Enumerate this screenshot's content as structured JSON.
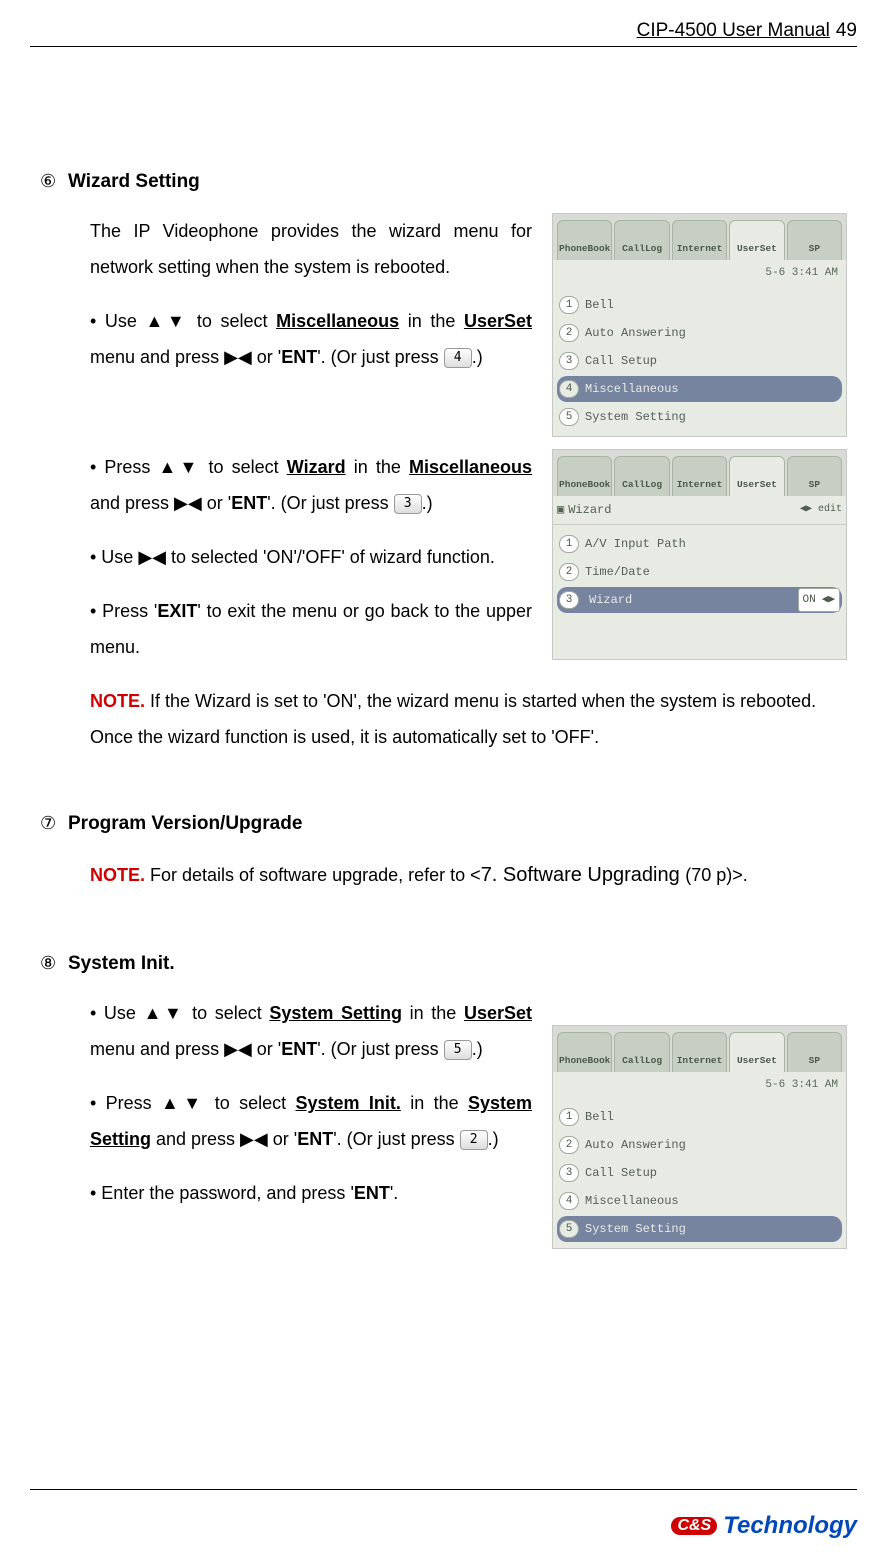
{
  "header": {
    "manual_title": "CIP-4500 User Manual",
    "page_no": "49"
  },
  "section6": {
    "marker": "⑥",
    "title": "Wizard Setting",
    "intro": "The IP Videophone provides the wizard menu for network setting when the system is rebooted.",
    "bullet1_a": "• Use ▲▼ to select ",
    "bullet1_b": "Miscellaneous",
    "bullet1_c": " in the ",
    "bullet1_d": "UserSet",
    "bullet1_e": " menu and press ▶◀ or '",
    "bullet1_f": "ENT",
    "bullet1_g": "'. (Or just press ",
    "bullet1_key": "4",
    "bullet1_h": ".)",
    "bullet2_a": "• Press ▲▼ to select ",
    "bullet2_b": "Wizard",
    "bullet2_c": " in the ",
    "bullet2_d": "Miscellaneous",
    "bullet2_e": " and press ▶◀ or '",
    "bullet2_f": "ENT",
    "bullet2_g": "'. (Or just press ",
    "bullet2_key": "3",
    "bullet2_h": ".)",
    "bullet3": "• Use ▶◀ to selected 'ON'/'OFF' of wizard function.",
    "bullet4_a": "• Press '",
    "bullet4_b": "EXIT",
    "bullet4_c": "' to exit the menu or go back to the upper menu.",
    "note_label": "NOTE.",
    "note_text": " If the Wizard is set to 'ON', the wizard menu is started when the system is rebooted. Once the wizard function is used, it is automatically set to 'OFF'."
  },
  "screenshot1": {
    "tabs": [
      "PhoneBook",
      "CallLog",
      "Internet",
      "UserSet",
      "SP"
    ],
    "active_tab_index": 3,
    "status": "5-6   3:41 AM",
    "items": [
      {
        "num": "1",
        "label": "Bell"
      },
      {
        "num": "2",
        "label": "Auto Answering"
      },
      {
        "num": "3",
        "label": "Call Setup"
      },
      {
        "num": "4",
        "label": "Miscellaneous"
      },
      {
        "num": "5",
        "label": "System Setting"
      }
    ],
    "selected_index": 3
  },
  "screenshot2": {
    "tabs": [
      "PhoneBook",
      "CallLog",
      "Internet",
      "UserSet",
      "SP"
    ],
    "active_tab_index": 3,
    "header_item": {
      "label": "Wizard",
      "action": "◀▶ edit"
    },
    "rows": [
      {
        "num": "1",
        "label": "A/V Input Path",
        "type": "item"
      },
      {
        "num": "2",
        "label": "Time/Date",
        "type": "item"
      },
      {
        "num": "3",
        "label": "Wizard",
        "type": "select",
        "value": "ON"
      }
    ],
    "selected_index": 2
  },
  "section7": {
    "marker": "⑦",
    "title": "Program Version/Upgrade",
    "note_label": "NOTE.",
    "note_text_a": " For details of software upgrade, refer to <",
    "note_text_b": "7. Software Upgrading ",
    "note_text_c": "(70 p)>."
  },
  "section8": {
    "marker": "⑧",
    "title": "System Init.",
    "bullet1_a": "• Use ▲▼ to select ",
    "bullet1_b": "System Setting",
    "bullet1_c": " in the ",
    "bullet1_d": "UserSet",
    "bullet1_e": " menu and press ▶◀ or '",
    "bullet1_f": "ENT",
    "bullet1_g": "'. (Or just press ",
    "bullet1_key": "5",
    "bullet1_h": ".)",
    "bullet2_a": "• Press ▲▼ to select ",
    "bullet2_b": "System Init.",
    "bullet2_c": " in the ",
    "bullet2_d": "System Setting",
    "bullet2_e": " and press ▶◀ or '",
    "bullet2_f": "ENT",
    "bullet2_g": "'. (Or just press ",
    "bullet2_key": "2",
    "bullet2_h": ".)",
    "bullet3_a": "• Enter the password, and press '",
    "bullet3_b": "ENT",
    "bullet3_c": "'."
  },
  "screenshot3": {
    "tabs": [
      "PhoneBook",
      "CallLog",
      "Internet",
      "UserSet",
      "SP"
    ],
    "active_tab_index": 3,
    "status": "5-6   3:41 AM",
    "items": [
      {
        "num": "1",
        "label": "Bell"
      },
      {
        "num": "2",
        "label": "Auto Answering"
      },
      {
        "num": "3",
        "label": "Call Setup"
      },
      {
        "num": "4",
        "label": "Miscellaneous"
      },
      {
        "num": "5",
        "label": "System Setting"
      }
    ],
    "selected_index": 4
  },
  "footer": {
    "logo_badge": "C&S",
    "logo_text": "Technology"
  }
}
